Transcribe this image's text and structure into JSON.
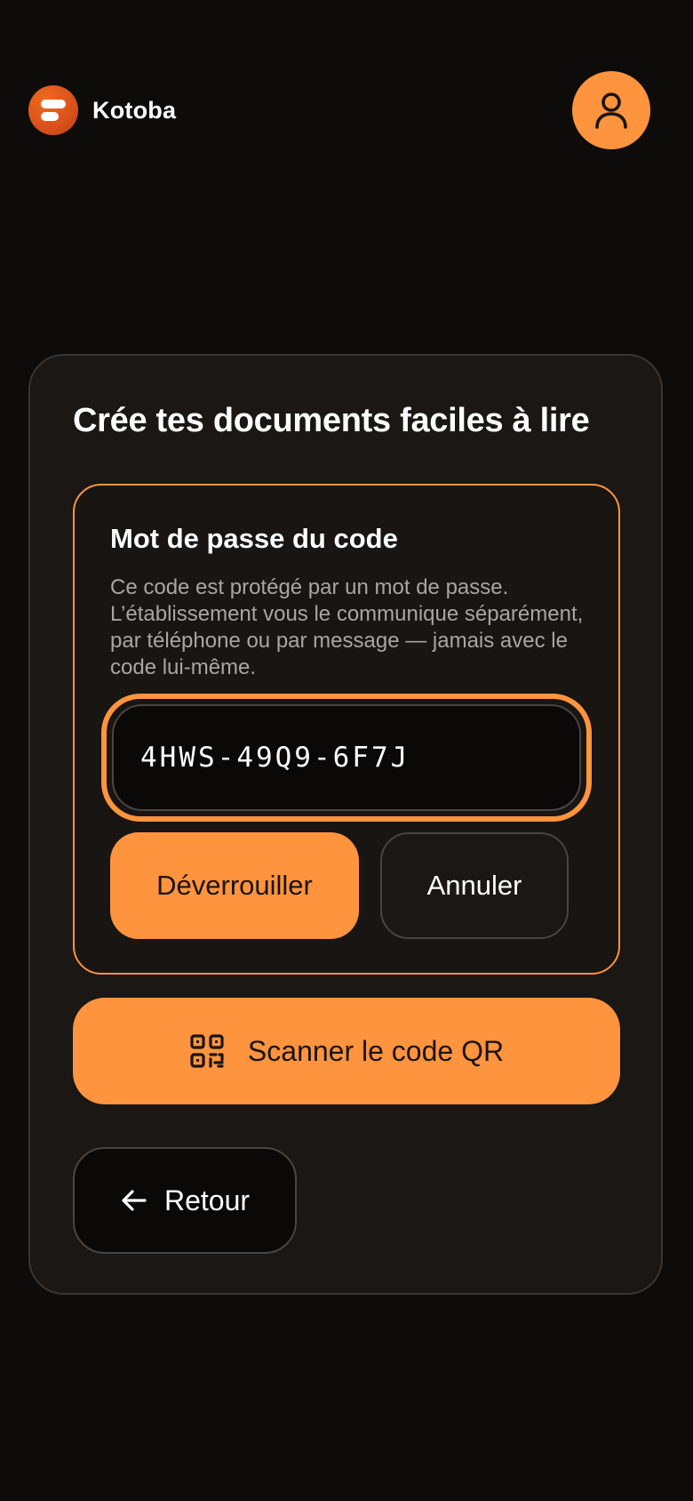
{
  "header": {
    "brand_name": "Kotoba",
    "logo_icon": "kotoba-logo",
    "profile_icon": "user-icon"
  },
  "card": {
    "title": "Crée tes documents faciles à lire"
  },
  "password_panel": {
    "heading": "Mot de passe du code",
    "description": "Ce code est protégé par un mot de passe. L’établissement vous le communique séparément, par téléphone ou par message — jamais avec le code lui-même.",
    "input_value": "4HWS-49Q9-6F7J",
    "unlock_label": "Déverrouiller",
    "cancel_label": "Annuler"
  },
  "actions": {
    "scan_label": "Scanner le code QR",
    "scan_icon": "qr-code-icon",
    "back_label": "Retour",
    "back_icon": "arrow-left-icon"
  },
  "colors": {
    "accent": "#ff943e",
    "background": "#0e0c0b",
    "card": "#1a1715",
    "logo": "#d9501b"
  }
}
